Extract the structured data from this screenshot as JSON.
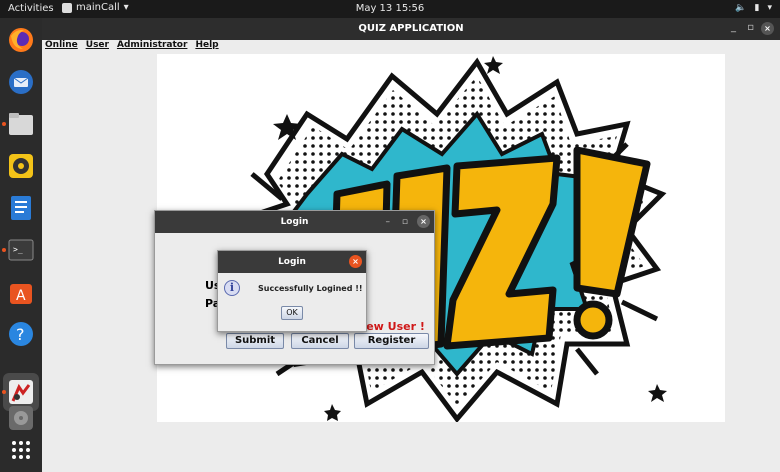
{
  "topbar": {
    "activities": "Activities",
    "app_menu": "mainCall",
    "clock": "May 13  15:56"
  },
  "dock": {
    "icons": [
      "firefox-icon",
      "thunderbird-icon",
      "files-icon",
      "rhythmbox-icon",
      "writer-icon",
      "terminal-icon",
      "software-icon",
      "help-icon",
      "java-icon",
      "disc-icon",
      "apps-grid-icon"
    ]
  },
  "window": {
    "title": "QUIZ APPLICATION",
    "minimize": "_",
    "maximize": "▫",
    "close": "×"
  },
  "menubar": {
    "items": [
      "Online",
      "User",
      "Administrator",
      "Help"
    ]
  },
  "login_dialog": {
    "title": "Login",
    "label_user_partial": "Us",
    "label_pass_partial": "Pa",
    "new_user_text": "New User !",
    "submit": "Submit",
    "cancel": "Cancel",
    "register": "Register"
  },
  "message_dialog": {
    "title": "Login",
    "message": "Successfully Logined !!",
    "ok": "OK"
  },
  "art": {
    "logo_text": "QUIZ!"
  },
  "colors": {
    "accent": "#e95420",
    "quiz_yellow": "#f5b50c",
    "burst_blue": "#2fb7cc"
  }
}
